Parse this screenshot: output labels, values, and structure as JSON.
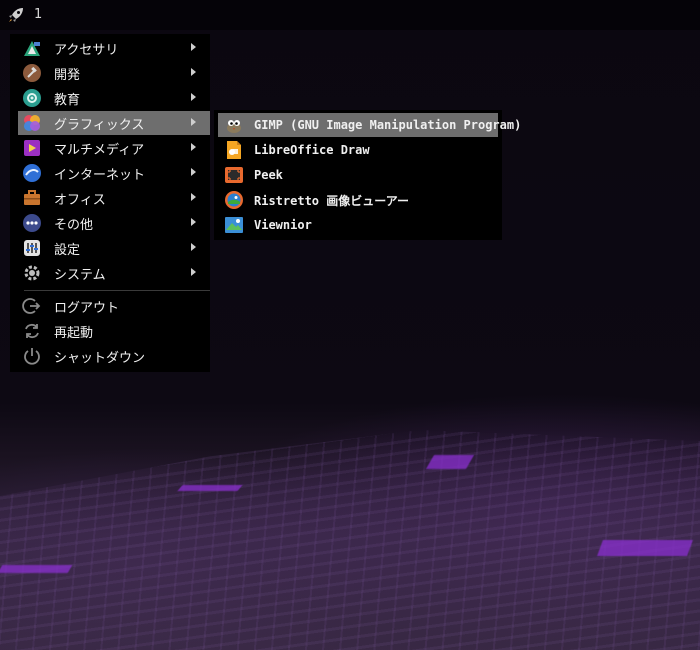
{
  "topbar": {
    "workspace_number": "1",
    "launcher_icon": "rocket-icon"
  },
  "main_menu": {
    "categories": [
      {
        "label": "アクセサリ",
        "icon": "accessories-icon"
      },
      {
        "label": "開発",
        "icon": "development-icon"
      },
      {
        "label": "教育",
        "icon": "education-icon"
      },
      {
        "label": "グラフィックス",
        "icon": "graphics-icon",
        "highlighted": true
      },
      {
        "label": "マルチメディア",
        "icon": "multimedia-icon"
      },
      {
        "label": "インターネット",
        "icon": "internet-icon"
      },
      {
        "label": "オフィス",
        "icon": "office-icon"
      },
      {
        "label": "その他",
        "icon": "other-icon"
      },
      {
        "label": "設定",
        "icon": "settings-icon"
      },
      {
        "label": "システム",
        "icon": "system-icon"
      }
    ],
    "actions": [
      {
        "label": "ログアウト",
        "icon": "logout-icon"
      },
      {
        "label": "再起動",
        "icon": "restart-icon"
      },
      {
        "label": "シャットダウン",
        "icon": "power-icon"
      }
    ]
  },
  "graphics_submenu": {
    "items": [
      {
        "label": "GIMP (GNU Image Manipulation Program)",
        "icon": "gimp-icon",
        "highlighted": true
      },
      {
        "label": "LibreOffice Draw",
        "icon": "libreoffice-draw-icon"
      },
      {
        "label": "Peek",
        "icon": "peek-icon"
      },
      {
        "label": "Ristretto 画像ビューアー",
        "icon": "ristretto-icon"
      },
      {
        "label": "Viewnior",
        "icon": "viewnior-icon"
      }
    ]
  },
  "colors": {
    "menu_bg": "#000000",
    "highlight": "#6e6e6e",
    "topbar_bg": "#050308",
    "neon_accent": "#8a2fd0"
  }
}
